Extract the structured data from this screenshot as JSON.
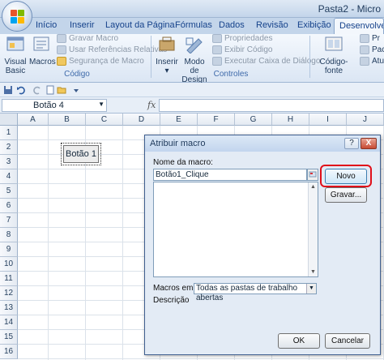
{
  "window": {
    "title": "Pasta2 - Micro"
  },
  "tabs": [
    {
      "label": "Início"
    },
    {
      "label": "Inserir"
    },
    {
      "label": "Layout da Página"
    },
    {
      "label": "Fórmulas"
    },
    {
      "label": "Dados"
    },
    {
      "label": "Revisão"
    },
    {
      "label": "Exibição"
    },
    {
      "label": "Desenvolvedor"
    }
  ],
  "ribbon": {
    "code_group": {
      "label": "Código",
      "visual_basic": "Visual Basic",
      "macros": "Macros",
      "record_macro": "Gravar Macro",
      "relative_refs": "Usar Referências Relativas",
      "macro_security": "Segurança de Macro"
    },
    "controls_group": {
      "label": "Controles",
      "insert": "Inserir",
      "design_mode": "Modo de Design",
      "properties": "Propriedades",
      "view_code": "Exibir Código",
      "run_dialog": "Executar Caixa de Diálogo"
    },
    "xml": {
      "source": "Código-fonte",
      "map": "Pr",
      "pack": "Paco",
      "refresh": "Atu"
    }
  },
  "formula_bar": {
    "name_box": "Botão 4",
    "fx": "fx",
    "value": ""
  },
  "sheet": {
    "columns": [
      "A",
      "B",
      "C",
      "D",
      "E",
      "F",
      "G",
      "H",
      "I",
      "J"
    ],
    "rows": [
      "1",
      "2",
      "3",
      "4",
      "5",
      "6",
      "7",
      "8",
      "9",
      "10",
      "11",
      "12",
      "13",
      "14",
      "15",
      "16"
    ],
    "form_button_label": "Botão 1"
  },
  "dialog": {
    "title": "Atribuir macro",
    "help": "?",
    "close": "X",
    "macro_name_label": "Nome da macro:",
    "macro_name_value": "Botão1_Clique",
    "new_button": "Novo",
    "record_button": "Gravar...",
    "macros_in_label": "Macros em:",
    "macros_in_value": "Todas as pastas de trabalho abertas",
    "description_label": "Descrição",
    "ok_button": "OK",
    "cancel_button": "Cancelar"
  },
  "colors": {
    "highlight": "#e0101a",
    "ribbon": "#dbe6f4",
    "accent": "#15428b"
  }
}
